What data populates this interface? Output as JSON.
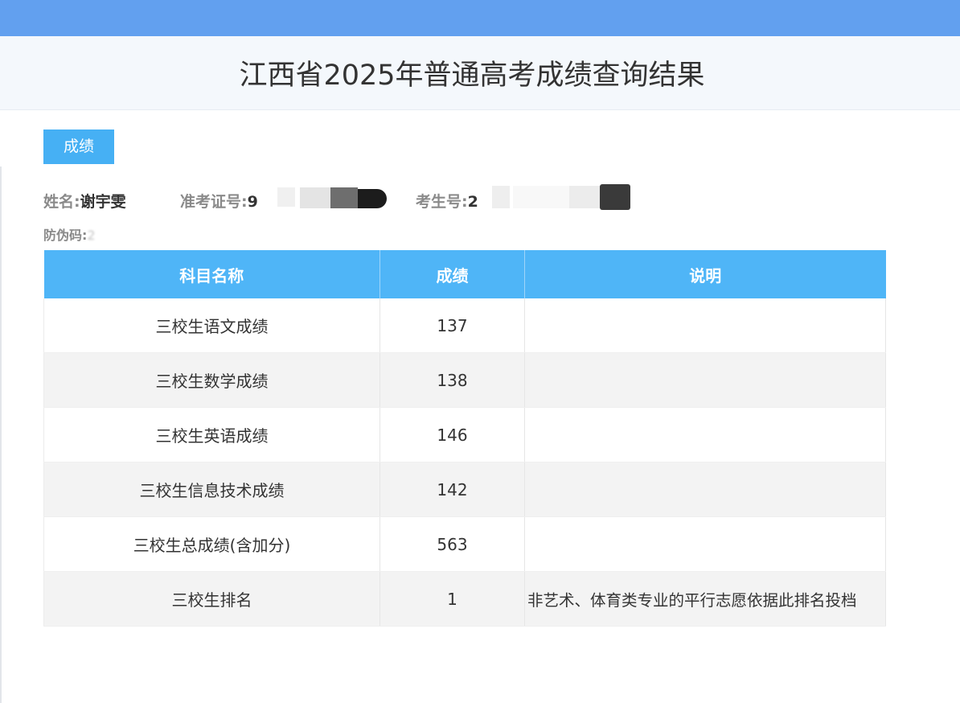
{
  "page": {
    "title": "江西省2025年普通高考成绩查询结果"
  },
  "tab": {
    "label": "成绩"
  },
  "student": {
    "name_label": "姓名:",
    "name_value": "谢宇雯",
    "ticket_label": "准考证号:",
    "ticket_visible": "9",
    "exam_label": "考生号:",
    "exam_visible": "2",
    "anticounterfeit_label": "防伪码:",
    "anticounterfeit_value": "2"
  },
  "table": {
    "headers": [
      "科目名称",
      "成绩",
      "说明"
    ],
    "rows": [
      {
        "subject": "三校生语文成绩",
        "score": "137",
        "note": ""
      },
      {
        "subject": "三校生数学成绩",
        "score": "138",
        "note": ""
      },
      {
        "subject": "三校生英语成绩",
        "score": "146",
        "note": ""
      },
      {
        "subject": "三校生信息技术成绩",
        "score": "142",
        "note": ""
      },
      {
        "subject": "三校生总成绩(含加分)",
        "score": "563",
        "note": ""
      },
      {
        "subject": "三校生排名",
        "score": "1",
        "note": "非艺术、体育类专业的平行志愿依据此排名投档"
      }
    ]
  },
  "colors": {
    "top_bar": "#62a0ef",
    "header_bg": "#f4f8fc",
    "table_header": "#4fb5f7",
    "tab_bg": "#46b0f4"
  }
}
